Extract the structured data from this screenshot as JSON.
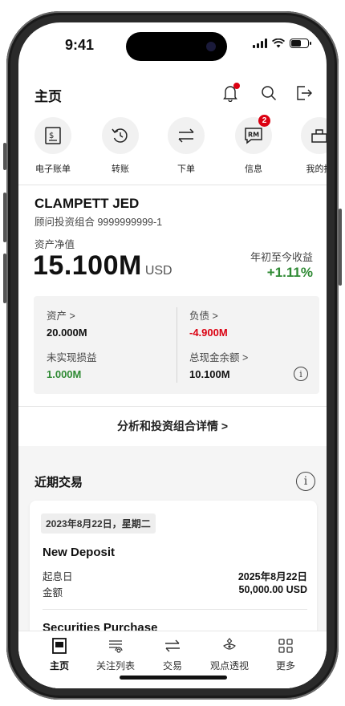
{
  "status_bar": {
    "time": "9:41"
  },
  "header": {
    "title": "主页"
  },
  "quick_actions": [
    {
      "label": "电子账单",
      "icon": "statement-icon"
    },
    {
      "label": "转账",
      "icon": "transfer-icon"
    },
    {
      "label": "下单",
      "icon": "order-icon"
    },
    {
      "label": "信息",
      "icon": "message-icon",
      "badge": "2"
    },
    {
      "label": "我的投",
      "icon": "portfolio-icon"
    }
  ],
  "account": {
    "name": "CLAMPETT JED",
    "subtitle": "顾问投资组合 9999999999-1",
    "net_value_label": "资产净值",
    "net_value": "15.100",
    "net_value_unit": "M",
    "net_value_currency": "USD",
    "ytd_label": "年初至今收益",
    "ytd_value": "+1.11%"
  },
  "summary": {
    "assets_label": "资产 >",
    "assets_value": "20.000M",
    "liabilities_label": "负债 >",
    "liabilities_value": "-4.900M",
    "unrealized_label": "未实现损益",
    "unrealized_value": "1.000M",
    "cash_label": "总现金余额 >",
    "cash_value": "10.100M"
  },
  "detail_link": "分析和投资组合详情 >",
  "recent": {
    "title": "近期交易",
    "date_chip": "2023年8月22日，星期二",
    "tx1_title": "New Deposit",
    "value_date_label": "起息日",
    "value_date": "2025年8月22日",
    "amount_label": "金额",
    "amount": "50,000.00 USD",
    "tx2_title": "Securities Purchase"
  },
  "tabs": [
    {
      "label": "主页",
      "icon": "home-icon"
    },
    {
      "label": "关注列表",
      "icon": "watchlist-icon"
    },
    {
      "label": "交易",
      "icon": "trade-icon"
    },
    {
      "label": "观点透视",
      "icon": "insights-icon"
    },
    {
      "label": "更多",
      "icon": "more-grid-icon"
    }
  ],
  "colors": {
    "brand_red": "#db0011",
    "positive_green": "#2f8a34"
  }
}
